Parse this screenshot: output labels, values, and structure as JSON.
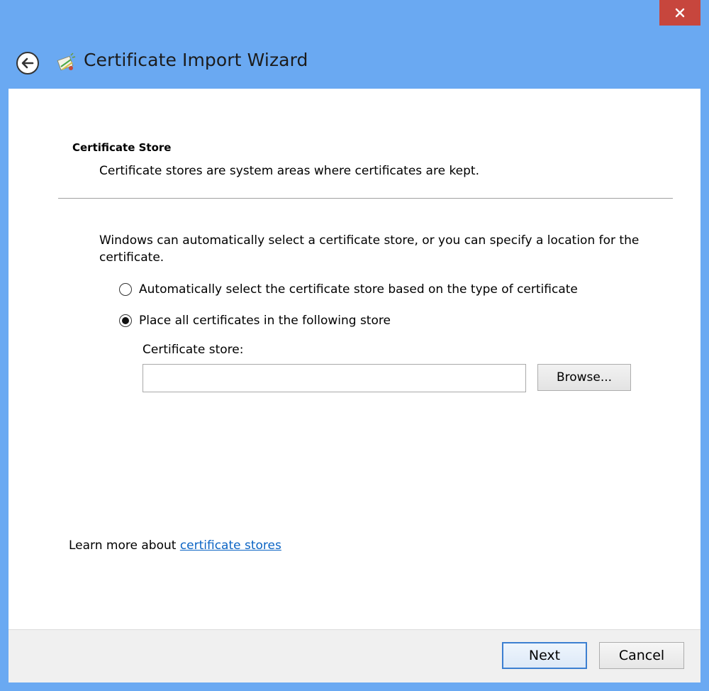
{
  "window": {
    "title": "Certificate Import Wizard",
    "accent_color": "#6aa9f2",
    "close_color": "#c7463d"
  },
  "icons": {
    "close": "close-icon",
    "back": "back-arrow-icon",
    "wizard": "certificate-wizard-icon"
  },
  "header": {
    "heading": "Certificate Store",
    "subtitle": "Certificate stores are system areas where certificates are kept."
  },
  "body": {
    "intro": "Windows can automatically select a certificate store, or you can specify a location for the certificate.",
    "options": [
      {
        "label": "Automatically select the certificate store based on the type of certificate",
        "selected": false
      },
      {
        "label": "Place all certificates in the following store",
        "selected": true
      }
    ],
    "store_label": "Certificate store:",
    "store_value": "",
    "browse_label": "Browse..."
  },
  "learn_more": {
    "prefix": "Learn more about ",
    "link_text": "certificate stores"
  },
  "footer": {
    "next_label": "Next",
    "cancel_label": "Cancel"
  }
}
